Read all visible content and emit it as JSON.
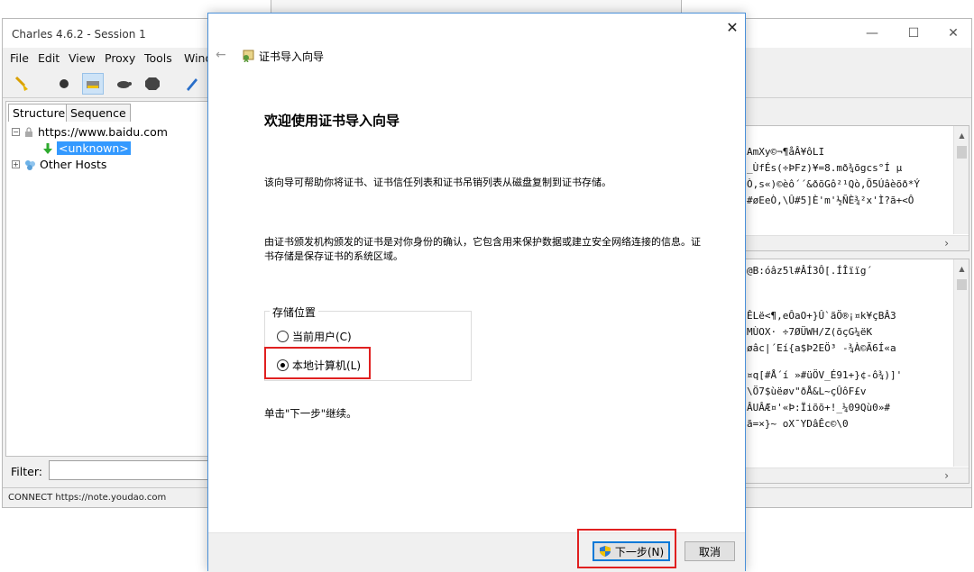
{
  "charles": {
    "title": "Charles 4.6.2 - Session 1",
    "menu": [
      "File",
      "Edit",
      "View",
      "Proxy",
      "Tools",
      "Wind"
    ],
    "tabs": {
      "structure": "Structure",
      "sequence": "Sequence"
    },
    "tree": {
      "host": "https://www.baidu.com",
      "child": "<unknown>",
      "other": "Other Hosts"
    },
    "filter_label": "Filter:",
    "status": "CONNECT https://note.youdao.com",
    "raw_top": [
      "AmXy©¬¶åÂ¥ôLI",
      "_ÙfÉs(÷ÞFz)¥=8.mð¾õgcs°Í µ",
      "Ò,s«)©èô´´&ðõGô²¹Qò,Õ5Úâèõð*Ý",
      "#øEeÒ,\\Û#5]È'm'½ÑÈ¾²x'Ì?ã+<Ô"
    ],
    "raw_bot": [
      "@B:óâz5l#ÂÍ3Ô[.ÍÎïïg´",
      "",
      "ÊLë<¶,eÔaO+}Û`ãÖ®¡¤k¥çBÂ3",
      "MÙOX·  ÷7ØÜWH/Z(õçG¼ëK",
      "øâc|´Eí{a$Þ2EÖ³ -¾À©Ã6Í«a",
      "",
      "¤q[#Å´í »#üÖV_É91+}¢-ô¾)]'",
      "\\Ö7$ùëøv\"ðÅ&L~çÛôF£v",
      "ÂUÂÆ¤'«Þ:Ïiõõ+!_¼09Qù0»#",
      "ã=×}~    oX¯YDâÊc©\\0"
    ]
  },
  "dialog": {
    "window_title": "证书导入向导",
    "heading": "欢迎使用证书导入向导",
    "para1": "该向导可帮助你将证书、证书信任列表和证书吊销列表从磁盘复制到证书存储。",
    "para2": "由证书颁发机构颁发的证书是对你身份的确认，它包含用来保护数据或建立安全网络连接的信息。证书存储是保存证书的系统区域。",
    "store_legend": "存储位置",
    "option_current_user": "当前用户(C)",
    "option_local_machine": "本地计算机(L)",
    "selected": "local_machine",
    "hint": "单击\"下一步\"继续。",
    "next_label": "下一步(N)",
    "cancel_label": "取消"
  },
  "colors": {
    "highlight_red": "#e02020",
    "accent_blue": "#0078d7",
    "selection": "#3399ff"
  }
}
